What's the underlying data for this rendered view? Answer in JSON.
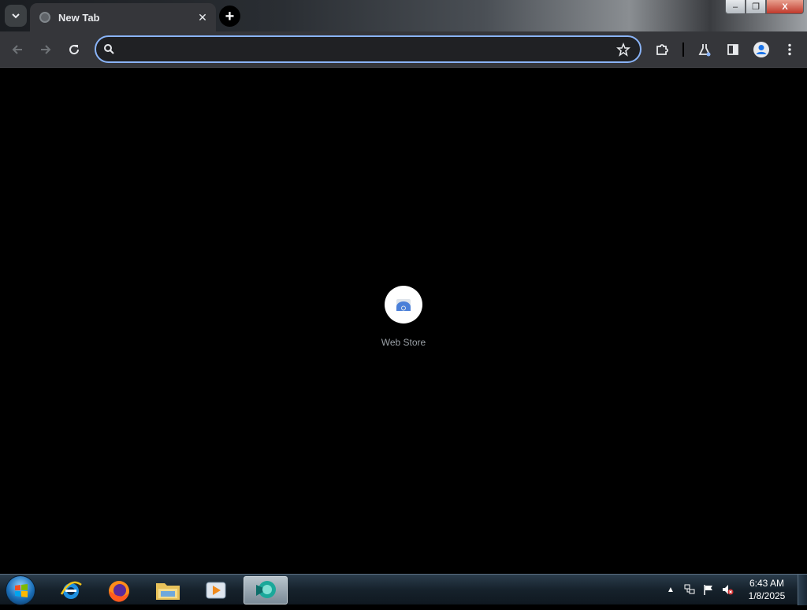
{
  "browser": {
    "tab": {
      "title": "New Tab",
      "close_icon": "close-icon"
    },
    "new_tab_label": "+",
    "window_controls": {
      "minimize": "–",
      "maximize": "❐",
      "close": "X"
    },
    "omnibox": {
      "value": "",
      "placeholder": ""
    },
    "accent": "#8ab4f8"
  },
  "content": {
    "shortcuts": [
      {
        "label": "Web Store",
        "icon": "web-store-icon"
      }
    ]
  },
  "taskbar": {
    "apps": [
      "start-orb",
      "internet-explorer",
      "firefox",
      "file-explorer",
      "media-player",
      "active-app"
    ],
    "clock": {
      "time": "6:43 AM",
      "date": "1/8/2025"
    },
    "tray_expand": "▲"
  }
}
